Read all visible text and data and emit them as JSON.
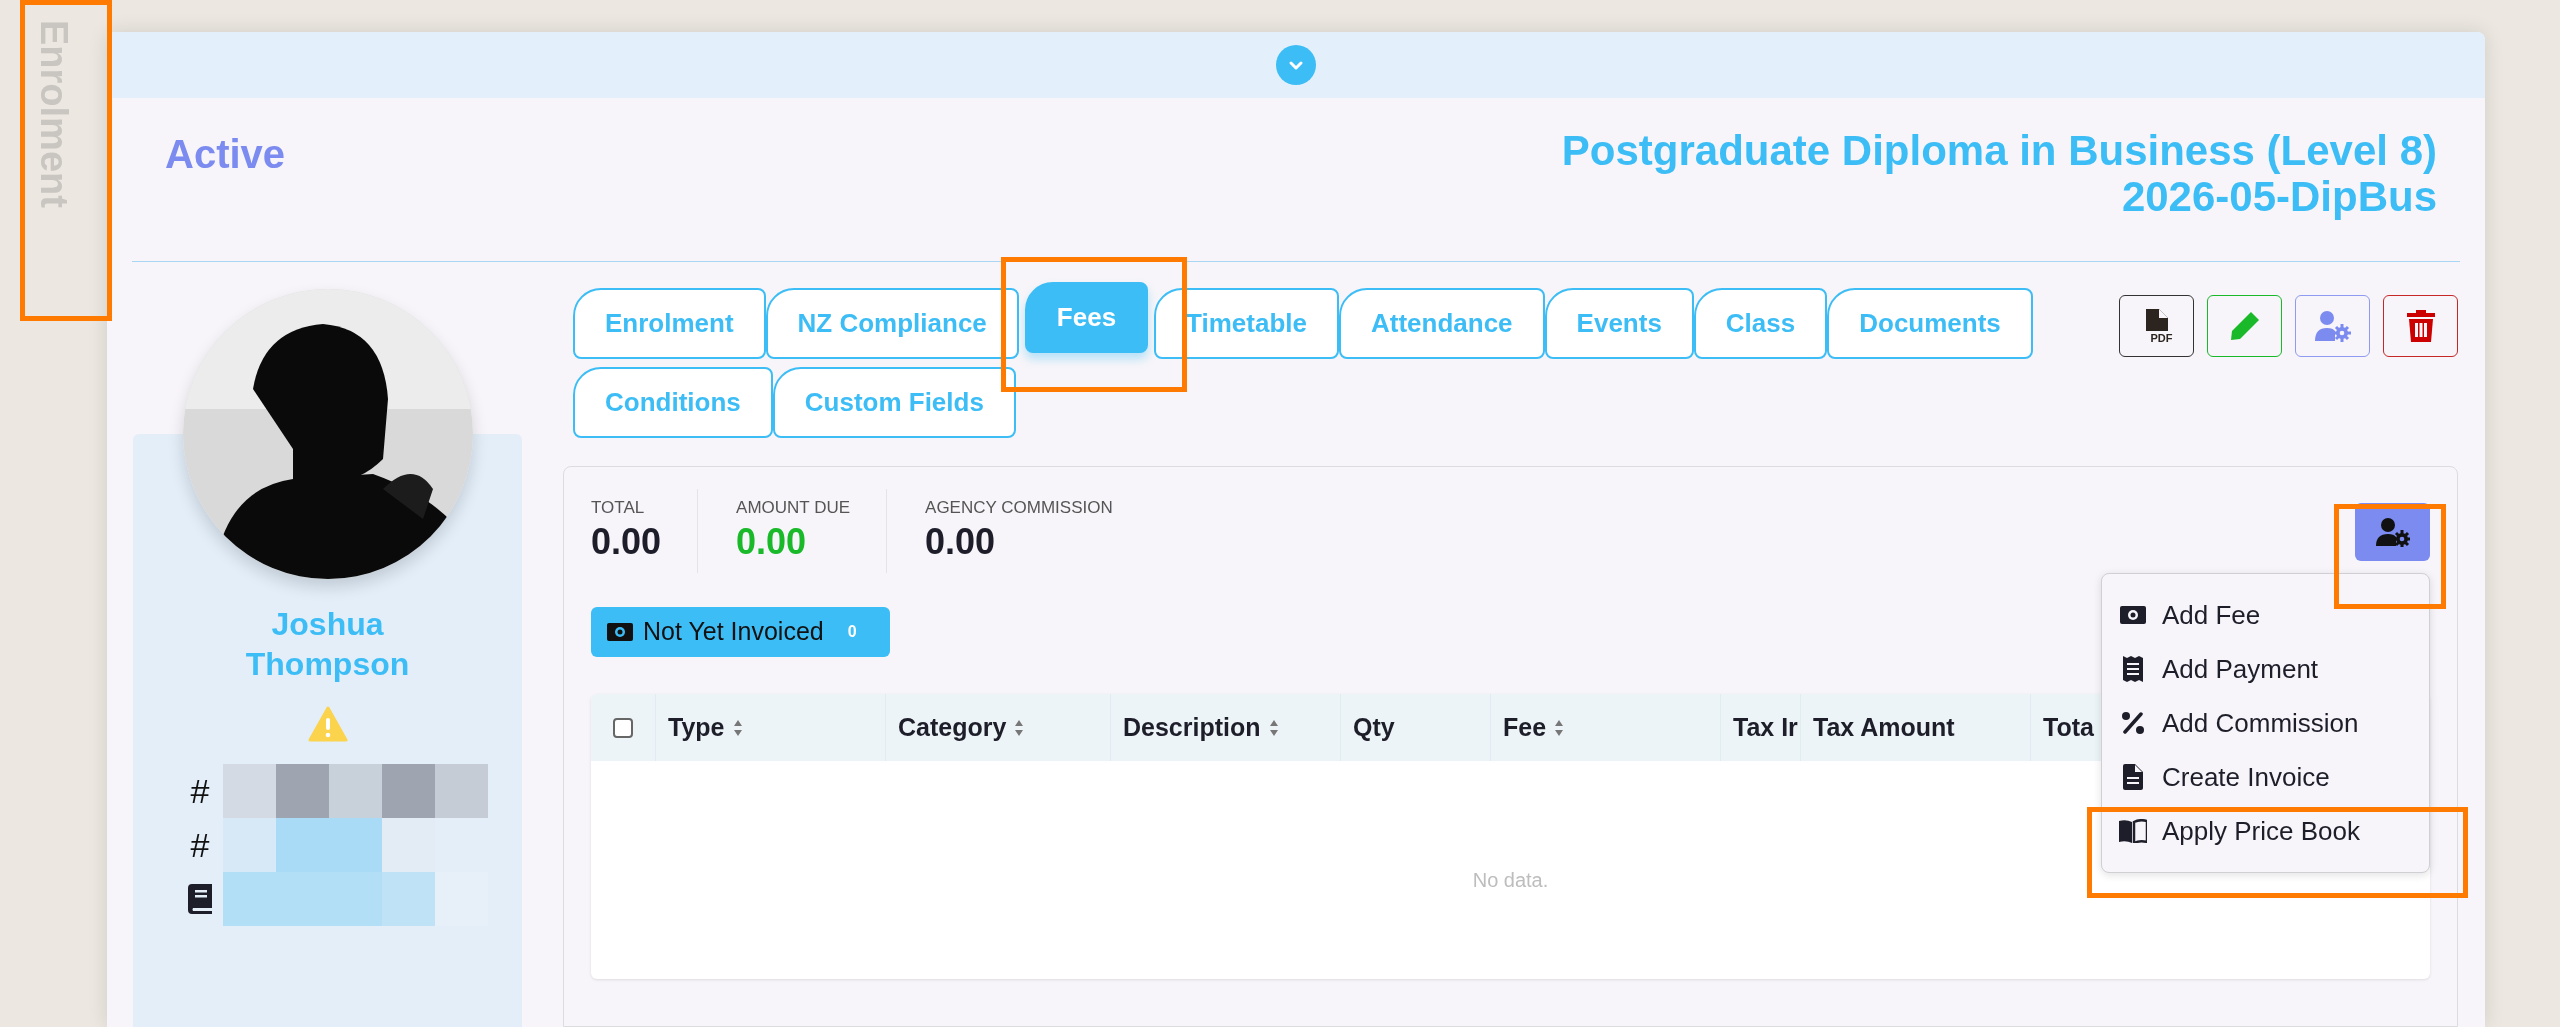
{
  "side_tab": {
    "label": "Enrolment"
  },
  "header": {
    "status": "Active",
    "title": "Postgraduate Diploma in Business (Level 8)",
    "code": "2026-05-DipBus"
  },
  "student": {
    "name": "Joshua Thompson",
    "has_warning": true,
    "details": [
      {
        "kind": "number",
        "symbol": "#"
      },
      {
        "kind": "number",
        "symbol": "#"
      },
      {
        "kind": "book"
      }
    ]
  },
  "tabs": [
    {
      "label": "Enrolment",
      "selected": false
    },
    {
      "label": "NZ Compliance",
      "selected": false
    },
    {
      "label": "Fees",
      "selected": true
    },
    {
      "label": "Timetable",
      "selected": false
    },
    {
      "label": "Attendance",
      "selected": false
    },
    {
      "label": "Events",
      "selected": false
    },
    {
      "label": "Class",
      "selected": false
    },
    {
      "label": "Documents",
      "selected": false
    },
    {
      "label": "Conditions",
      "selected": false
    },
    {
      "label": "Custom Fields",
      "selected": false
    }
  ],
  "actions": [
    {
      "kind": "pdf",
      "badge": "PDF"
    },
    {
      "kind": "edit"
    },
    {
      "kind": "manage"
    },
    {
      "kind": "delete"
    }
  ],
  "fees": {
    "stats": [
      {
        "label": "TOTAL",
        "value": "0.00",
        "kind": "plain"
      },
      {
        "label": "AMOUNT DUE",
        "value": "0.00",
        "kind": "due"
      },
      {
        "label": "AGENCY COMMISSION",
        "value": "0.00",
        "kind": "plain"
      }
    ],
    "filter": {
      "label": "Not Yet Invoiced",
      "count": "0"
    },
    "table": {
      "select_all_checked": false,
      "columns": [
        {
          "label": "Type",
          "sortable": true
        },
        {
          "label": "Category",
          "sortable": true
        },
        {
          "label": "Description",
          "sortable": true
        },
        {
          "label": "Qty",
          "sortable": false
        },
        {
          "label": "Fee",
          "sortable": true
        },
        {
          "label": "Tax Ir"
        },
        {
          "label": "Tax Amount",
          "sortable": false
        },
        {
          "label": "Tota"
        }
      ],
      "empty_text": "No data."
    },
    "menu": {
      "open": true,
      "items": [
        {
          "kind": "fee",
          "label": "Add Fee"
        },
        {
          "kind": "payment",
          "label": "Add Payment"
        },
        {
          "kind": "commission",
          "label": "Add Commission"
        },
        {
          "kind": "invoice",
          "label": "Create Invoice"
        },
        {
          "kind": "price_book",
          "label": "Apply Price Book"
        }
      ]
    }
  }
}
